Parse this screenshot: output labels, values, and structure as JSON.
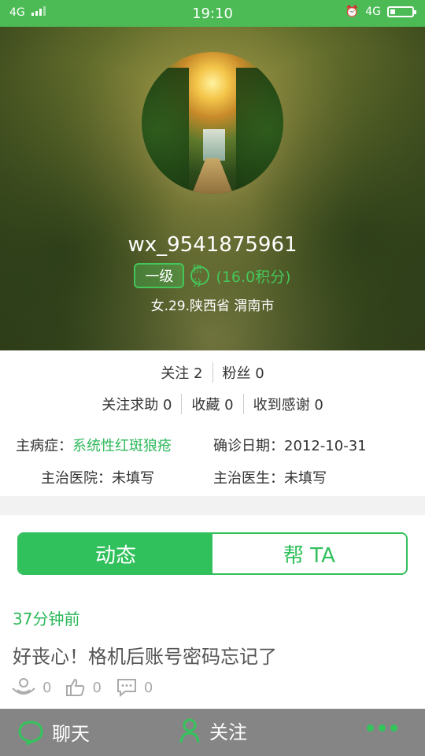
{
  "status_bar": {
    "network_left": "4G",
    "time": "19:10",
    "network_right": "4G",
    "alarm_icon": "alarm-clock-icon",
    "battery_icon": "battery-icon"
  },
  "profile": {
    "username": "wx_9541875961",
    "level_label": "一级",
    "points_icon_text": "积分",
    "points_text": "(16.0积分)",
    "user_info": "女.29.陕西省 渭南市"
  },
  "stats": {
    "following": "关注 2",
    "fans": "粉丝 0",
    "help_following": "关注求助 0",
    "favorites": "收藏 0",
    "thanks_received": "收到感谢 0"
  },
  "medical": {
    "main_condition_label": "主病症：",
    "main_condition_value": "系统性红斑狼疮",
    "diagnosis_date_label": "确诊日期：",
    "diagnosis_date_value": "2012-10-31",
    "hospital_label": "主治医院：",
    "hospital_value": "未填写",
    "doctor_label": "主治医生：",
    "doctor_value": "未填写"
  },
  "tabs": [
    {
      "label": "动态",
      "active": true
    },
    {
      "label": "帮 TA",
      "active": false
    }
  ],
  "post": {
    "time": "37分钟前",
    "content": "好丧心！格机后账号密码忘记了",
    "hug_count": "0",
    "like_count": "0",
    "comment_count": "0"
  },
  "bottom_bar": {
    "chat_label": "聊天",
    "follow_label": "关注"
  },
  "colors": {
    "accent_green": "#30c05c",
    "status_bar_green": "#4cbb55",
    "bottom_bar_gray": "#858585"
  }
}
